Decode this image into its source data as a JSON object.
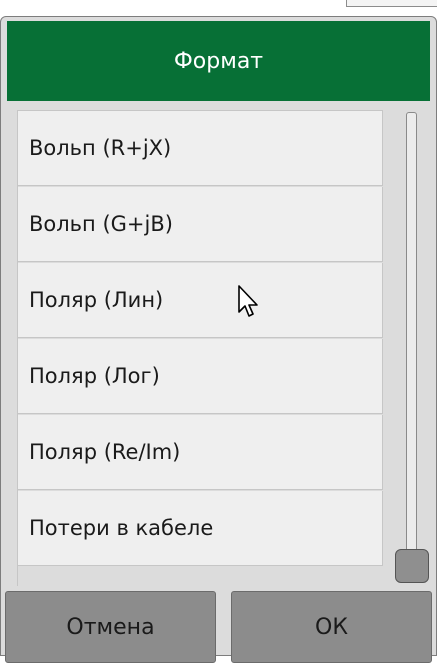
{
  "dialog": {
    "title": "Формат",
    "items": [
      {
        "label": "Вольп (R+jX)"
      },
      {
        "label": "Вольп (G+jB)"
      },
      {
        "label": "Поляр (Лин)"
      },
      {
        "label": "Поляр (Лог)"
      },
      {
        "label": "Поляр (Re/Im)"
      },
      {
        "label": "Потери в кабеле"
      }
    ],
    "cancel_label": "Отмена",
    "ok_label": "ОК"
  },
  "colors": {
    "title_bg": "#077036",
    "dialog_bg": "#dcdcdc",
    "item_bg": "#efefef",
    "button_bg": "#8c8c8c"
  },
  "icons": {
    "cursor": "arrow-cursor-icon"
  }
}
